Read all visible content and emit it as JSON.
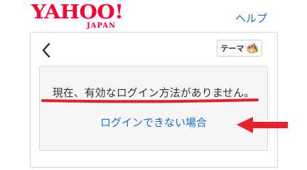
{
  "header": {
    "logo_text": "YAHOO!",
    "logo_sub": "JAPAN",
    "help_label": "ヘルプ"
  },
  "card": {
    "back_icon": "chevron-left-icon",
    "theme_label": "テーマ",
    "theme_icon": "palette-icon",
    "message": "現在、有効なログイン方法がありません。",
    "cant_login_label": "ログインできない場合"
  },
  "colors": {
    "brand_red": "#ff0033",
    "link_blue": "#1a6fd1",
    "annotation_red": "#e8202a"
  }
}
